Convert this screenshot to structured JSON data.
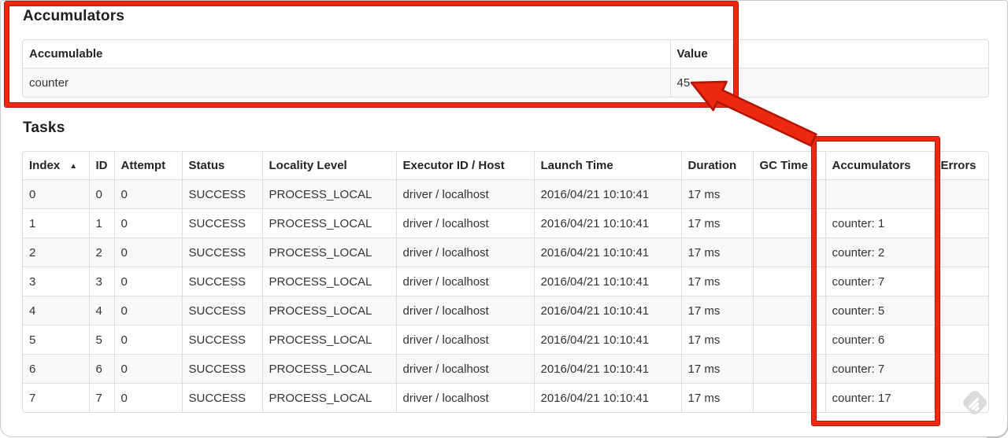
{
  "accumulators_section": {
    "title": "Accumulators",
    "table": {
      "headers": [
        "Accumulable",
        "Value"
      ],
      "rows": [
        [
          "counter",
          "45"
        ]
      ]
    }
  },
  "tasks_section": {
    "title": "Tasks",
    "table": {
      "headers": [
        "Index",
        "ID",
        "Attempt",
        "Status",
        "Locality Level",
        "Executor ID / Host",
        "Launch Time",
        "Duration",
        "GC Time",
        "Accumulators",
        "Errors"
      ],
      "sorted_column_index": 0,
      "sort_icon": "▲",
      "rows": [
        [
          "0",
          "0",
          "0",
          "SUCCESS",
          "PROCESS_LOCAL",
          "driver / localhost",
          "2016/04/21 10:10:41",
          "17 ms",
          "",
          "",
          ""
        ],
        [
          "1",
          "1",
          "0",
          "SUCCESS",
          "PROCESS_LOCAL",
          "driver / localhost",
          "2016/04/21 10:10:41",
          "17 ms",
          "",
          "counter: 1",
          ""
        ],
        [
          "2",
          "2",
          "0",
          "SUCCESS",
          "PROCESS_LOCAL",
          "driver / localhost",
          "2016/04/21 10:10:41",
          "17 ms",
          "",
          "counter: 2",
          ""
        ],
        [
          "3",
          "3",
          "0",
          "SUCCESS",
          "PROCESS_LOCAL",
          "driver / localhost",
          "2016/04/21 10:10:41",
          "17 ms",
          "",
          "counter: 7",
          ""
        ],
        [
          "4",
          "4",
          "0",
          "SUCCESS",
          "PROCESS_LOCAL",
          "driver / localhost",
          "2016/04/21 10:10:41",
          "17 ms",
          "",
          "counter: 5",
          ""
        ],
        [
          "5",
          "5",
          "0",
          "SUCCESS",
          "PROCESS_LOCAL",
          "driver / localhost",
          "2016/04/21 10:10:41",
          "17 ms",
          "",
          "counter: 6",
          ""
        ],
        [
          "6",
          "6",
          "0",
          "SUCCESS",
          "PROCESS_LOCAL",
          "driver / localhost",
          "2016/04/21 10:10:41",
          "17 ms",
          "",
          "counter: 7",
          ""
        ],
        [
          "7",
          "7",
          "0",
          "SUCCESS",
          "PROCESS_LOCAL",
          "driver / localhost",
          "2016/04/21 10:10:41",
          "17 ms",
          "",
          "counter: 17",
          ""
        ]
      ]
    }
  },
  "annotations": {
    "highlight_color": "#ee2711",
    "highlight_edge_color": "#b51a06",
    "boxed_regions": [
      "accumulators-summary-table",
      "tasks-accumulators-column"
    ],
    "arrow_points_to": "45"
  },
  "watermark": {
    "icon": "feedly-logo",
    "color": "#d9d9d9"
  }
}
